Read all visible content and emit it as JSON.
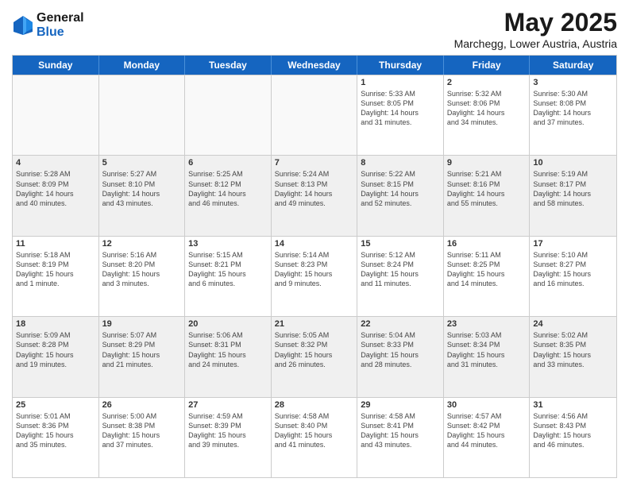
{
  "logo": {
    "general": "General",
    "blue": "Blue"
  },
  "header": {
    "month": "May 2025",
    "location": "Marchegg, Lower Austria, Austria"
  },
  "weekdays": [
    "Sunday",
    "Monday",
    "Tuesday",
    "Wednesday",
    "Thursday",
    "Friday",
    "Saturday"
  ],
  "rows": [
    [
      {
        "day": "",
        "text": "",
        "empty": true
      },
      {
        "day": "",
        "text": "",
        "empty": true
      },
      {
        "day": "",
        "text": "",
        "empty": true
      },
      {
        "day": "",
        "text": "",
        "empty": true
      },
      {
        "day": "1",
        "text": "Sunrise: 5:33 AM\nSunset: 8:05 PM\nDaylight: 14 hours\nand 31 minutes."
      },
      {
        "day": "2",
        "text": "Sunrise: 5:32 AM\nSunset: 8:06 PM\nDaylight: 14 hours\nand 34 minutes."
      },
      {
        "day": "3",
        "text": "Sunrise: 5:30 AM\nSunset: 8:08 PM\nDaylight: 14 hours\nand 37 minutes."
      }
    ],
    [
      {
        "day": "4",
        "text": "Sunrise: 5:28 AM\nSunset: 8:09 PM\nDaylight: 14 hours\nand 40 minutes."
      },
      {
        "day": "5",
        "text": "Sunrise: 5:27 AM\nSunset: 8:10 PM\nDaylight: 14 hours\nand 43 minutes."
      },
      {
        "day": "6",
        "text": "Sunrise: 5:25 AM\nSunset: 8:12 PM\nDaylight: 14 hours\nand 46 minutes."
      },
      {
        "day": "7",
        "text": "Sunrise: 5:24 AM\nSunset: 8:13 PM\nDaylight: 14 hours\nand 49 minutes."
      },
      {
        "day": "8",
        "text": "Sunrise: 5:22 AM\nSunset: 8:15 PM\nDaylight: 14 hours\nand 52 minutes."
      },
      {
        "day": "9",
        "text": "Sunrise: 5:21 AM\nSunset: 8:16 PM\nDaylight: 14 hours\nand 55 minutes."
      },
      {
        "day": "10",
        "text": "Sunrise: 5:19 AM\nSunset: 8:17 PM\nDaylight: 14 hours\nand 58 minutes."
      }
    ],
    [
      {
        "day": "11",
        "text": "Sunrise: 5:18 AM\nSunset: 8:19 PM\nDaylight: 15 hours\nand 1 minute."
      },
      {
        "day": "12",
        "text": "Sunrise: 5:16 AM\nSunset: 8:20 PM\nDaylight: 15 hours\nand 3 minutes."
      },
      {
        "day": "13",
        "text": "Sunrise: 5:15 AM\nSunset: 8:21 PM\nDaylight: 15 hours\nand 6 minutes."
      },
      {
        "day": "14",
        "text": "Sunrise: 5:14 AM\nSunset: 8:23 PM\nDaylight: 15 hours\nand 9 minutes."
      },
      {
        "day": "15",
        "text": "Sunrise: 5:12 AM\nSunset: 8:24 PM\nDaylight: 15 hours\nand 11 minutes."
      },
      {
        "day": "16",
        "text": "Sunrise: 5:11 AM\nSunset: 8:25 PM\nDaylight: 15 hours\nand 14 minutes."
      },
      {
        "day": "17",
        "text": "Sunrise: 5:10 AM\nSunset: 8:27 PM\nDaylight: 15 hours\nand 16 minutes."
      }
    ],
    [
      {
        "day": "18",
        "text": "Sunrise: 5:09 AM\nSunset: 8:28 PM\nDaylight: 15 hours\nand 19 minutes."
      },
      {
        "day": "19",
        "text": "Sunrise: 5:07 AM\nSunset: 8:29 PM\nDaylight: 15 hours\nand 21 minutes."
      },
      {
        "day": "20",
        "text": "Sunrise: 5:06 AM\nSunset: 8:31 PM\nDaylight: 15 hours\nand 24 minutes."
      },
      {
        "day": "21",
        "text": "Sunrise: 5:05 AM\nSunset: 8:32 PM\nDaylight: 15 hours\nand 26 minutes."
      },
      {
        "day": "22",
        "text": "Sunrise: 5:04 AM\nSunset: 8:33 PM\nDaylight: 15 hours\nand 28 minutes."
      },
      {
        "day": "23",
        "text": "Sunrise: 5:03 AM\nSunset: 8:34 PM\nDaylight: 15 hours\nand 31 minutes."
      },
      {
        "day": "24",
        "text": "Sunrise: 5:02 AM\nSunset: 8:35 PM\nDaylight: 15 hours\nand 33 minutes."
      }
    ],
    [
      {
        "day": "25",
        "text": "Sunrise: 5:01 AM\nSunset: 8:36 PM\nDaylight: 15 hours\nand 35 minutes."
      },
      {
        "day": "26",
        "text": "Sunrise: 5:00 AM\nSunset: 8:38 PM\nDaylight: 15 hours\nand 37 minutes."
      },
      {
        "day": "27",
        "text": "Sunrise: 4:59 AM\nSunset: 8:39 PM\nDaylight: 15 hours\nand 39 minutes."
      },
      {
        "day": "28",
        "text": "Sunrise: 4:58 AM\nSunset: 8:40 PM\nDaylight: 15 hours\nand 41 minutes."
      },
      {
        "day": "29",
        "text": "Sunrise: 4:58 AM\nSunset: 8:41 PM\nDaylight: 15 hours\nand 43 minutes."
      },
      {
        "day": "30",
        "text": "Sunrise: 4:57 AM\nSunset: 8:42 PM\nDaylight: 15 hours\nand 44 minutes."
      },
      {
        "day": "31",
        "text": "Sunrise: 4:56 AM\nSunset: 8:43 PM\nDaylight: 15 hours\nand 46 minutes."
      }
    ]
  ]
}
